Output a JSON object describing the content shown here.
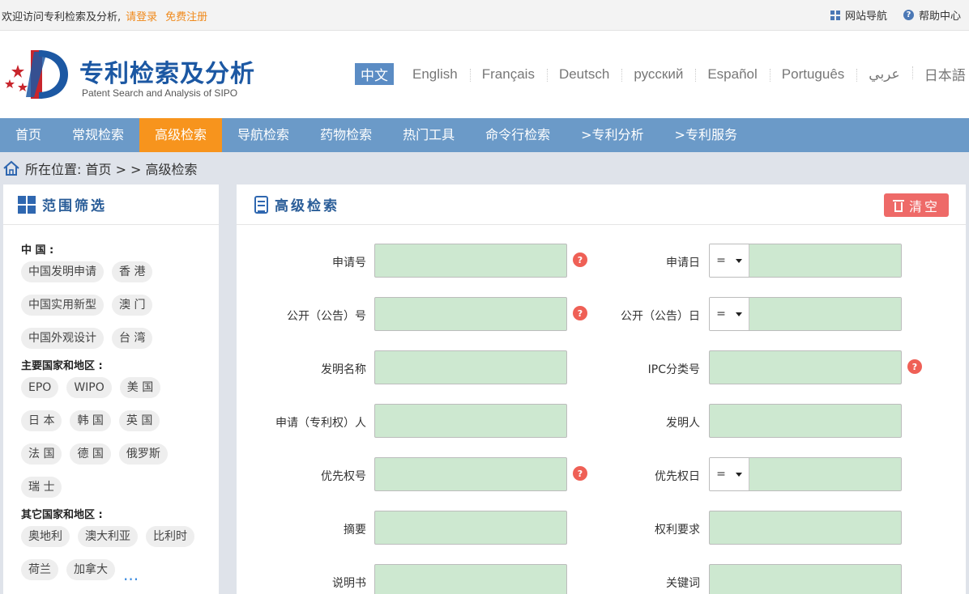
{
  "topbar": {
    "welcome": "欢迎访问专利检索及分析,",
    "login": "请登录",
    "register": "免费注册",
    "site_nav": "网站导航",
    "help": "帮助中心",
    "help_icon_glyph": "?"
  },
  "header": {
    "logo_cn": "专利检索及分析",
    "logo_en": "Patent Search and Analysis of SIPO",
    "languages": [
      "中文",
      "English",
      "Français",
      "Deutsch",
      "русский",
      "Español",
      "Português",
      "عربي",
      "日本語"
    ],
    "active_language": "中文"
  },
  "nav": {
    "items": [
      "首页",
      "常规检索",
      "高级检索",
      "导航检索",
      "药物检索",
      "热门工具",
      "命令行检索",
      ">专利分析",
      ">专利服务"
    ],
    "active": "高级检索"
  },
  "breadcrumb": {
    "text": "所在位置: 首页 > > 高级检索"
  },
  "scope_panel": {
    "title": "范围筛选",
    "groups": [
      {
        "title": "中 国 :",
        "tags": [
          "中国发明申请",
          "香 港",
          "中国实用新型",
          "澳 门",
          "中国外观设计",
          "台 湾"
        ]
      },
      {
        "title": "主要国家和地区 :",
        "tags": [
          "EPO",
          "WIPO",
          "美 国",
          "日 本",
          "韩 国",
          "英 国",
          "法 国",
          "德 国",
          "俄罗斯",
          "瑞 士"
        ]
      },
      {
        "title": "其它国家和地区 :",
        "tags": [
          "奥地利",
          "澳大利亚",
          "比利时",
          "荷兰",
          "加拿大"
        ]
      }
    ],
    "more": "..."
  },
  "search_panel": {
    "title": "高级检索",
    "clear": "清空",
    "operator": "=",
    "help_glyph": "?",
    "left_fields": [
      {
        "label": "申请号",
        "value": "",
        "help": true
      },
      {
        "label": "公开（公告）号",
        "value": "",
        "help": true
      },
      {
        "label": "发明名称",
        "value": "",
        "help": false
      },
      {
        "label": "申请（专利权）人",
        "value": "",
        "help": false
      },
      {
        "label": "优先权号",
        "value": "",
        "help": true
      },
      {
        "label": "摘要",
        "value": "",
        "help": false
      },
      {
        "label": "说明书",
        "value": "",
        "help": false
      }
    ],
    "right_fields": [
      {
        "label": "申请日",
        "value": "",
        "date": true,
        "help": false
      },
      {
        "label": "公开（公告）日",
        "value": "",
        "date": true,
        "help": false
      },
      {
        "label": "IPC分类号",
        "value": "",
        "date": false,
        "help": true
      },
      {
        "label": "发明人",
        "value": "",
        "date": false,
        "help": false
      },
      {
        "label": "优先权日",
        "value": "",
        "date": true,
        "help": false
      },
      {
        "label": "权利要求",
        "value": "",
        "date": false,
        "help": false
      },
      {
        "label": "关键词",
        "value": "",
        "date": false,
        "help": false
      }
    ]
  },
  "colors": {
    "nav_bg": "#6b9ac8",
    "nav_active": "#f7941d",
    "brand_blue": "#1c58a3",
    "input_bg": "#cde8d0",
    "clear_btn": "#ee6a68",
    "help_red": "#ef6056",
    "link_orange": "#f08a1c"
  },
  "icons": {
    "site_nav": "grid-icon",
    "help": "question-circle-icon",
    "breadcrumb": "home-icon",
    "scope": "windows-grid-icon",
    "search": "document-icon",
    "clear": "trash-icon",
    "field_help": "help-icon"
  }
}
